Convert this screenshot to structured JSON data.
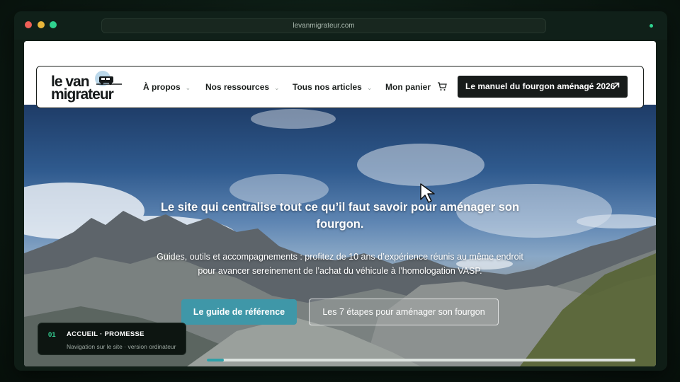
{
  "browser": {
    "url": "levanmigrateur.com"
  },
  "logo": {
    "line1": "le van",
    "line2": "migrateur"
  },
  "nav": {
    "items": [
      {
        "label": "À propos",
        "has_dropdown": true
      },
      {
        "label": "Nos ressources",
        "has_dropdown": true
      },
      {
        "label": "Tous nos articles",
        "has_dropdown": true
      },
      {
        "label": "Mon panier",
        "has_dropdown": false
      }
    ],
    "cta_label": "Le manuel du fourgon aménagé 2026"
  },
  "hero": {
    "title": "Le site qui centralise tout ce qu’il faut savoir pour aménager son fourgon.",
    "subtitle": "Guides, outils et accompagnements : profitez de 10 ans d’expérience réunis au même endroit pour avancer sereinement de l’achat du véhicule à l’homologation VASP.",
    "primary_button": "Le guide de référence",
    "secondary_button": "Les 7 étapes pour aménager son fourgon"
  },
  "step": {
    "number": "01",
    "title": "ACCUEIL · PROMESSE",
    "description": "Navigation sur le site · version ordinateur"
  },
  "progress": {
    "fraction": 0.01
  },
  "colors": {
    "accent": "#3f97a8",
    "cta_bg": "#171b1a",
    "step_accent": "#35d395"
  }
}
